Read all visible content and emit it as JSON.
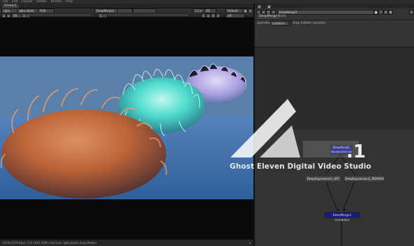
{
  "menubar": {
    "items": [
      "File",
      "Edit",
      "Layout",
      "Viewer",
      "Render",
      "Help"
    ]
  },
  "viewer": {
    "tab_label": "Viewer1",
    "toolbar": {
      "layer": "rgba",
      "channel": "rgba.alpha",
      "colorspace": "RGB",
      "input_a": "DeepMerge1",
      "input_b": "",
      "frame": "1",
      "zoom": "f/8",
      "gain": "1",
      "gamma": "1",
      "proxy": "1:1 ▾",
      "ratio": "2D",
      "lut": "Default",
      "stereo": "off",
      "time": "1"
    },
    "status": "1919x1079 bbox: 0 0 1920 1080 channels: rgba,depth,deep,Mattes",
    "bg_color": "#0a0a0a"
  },
  "properties": {
    "tabs": [
      "",
      "",
      ""
    ],
    "node_name": "DeepMerge1",
    "subtabs": [
      "DeepMerge",
      "Node"
    ],
    "operation_label": "operation",
    "operation_value": "combine",
    "drop_hidden_label": "drop hidden samples"
  },
  "nodegraph": {
    "nodes": {
      "deepread_line1": "DeepRead1",
      "deepread_line2": "dfsofpts0000.exr",
      "expr_left": "DeepExpression1_SET",
      "expr_right": "DeepExpression1_REMOVE",
      "merge": "DeepMerge1 (combine)"
    },
    "colors": {
      "deep": "#1a1c7a",
      "line": "#0d0d0d"
    }
  },
  "watermark": {
    "text": "Ghost Eleven Digital Video Studio",
    "badge": ".11"
  },
  "render_scene": {
    "sky_color": "#5a7fa8",
    "floor_color": "#3b6aa4",
    "objects": [
      "orange-furball",
      "teal-furball",
      "lavender-furball"
    ]
  }
}
